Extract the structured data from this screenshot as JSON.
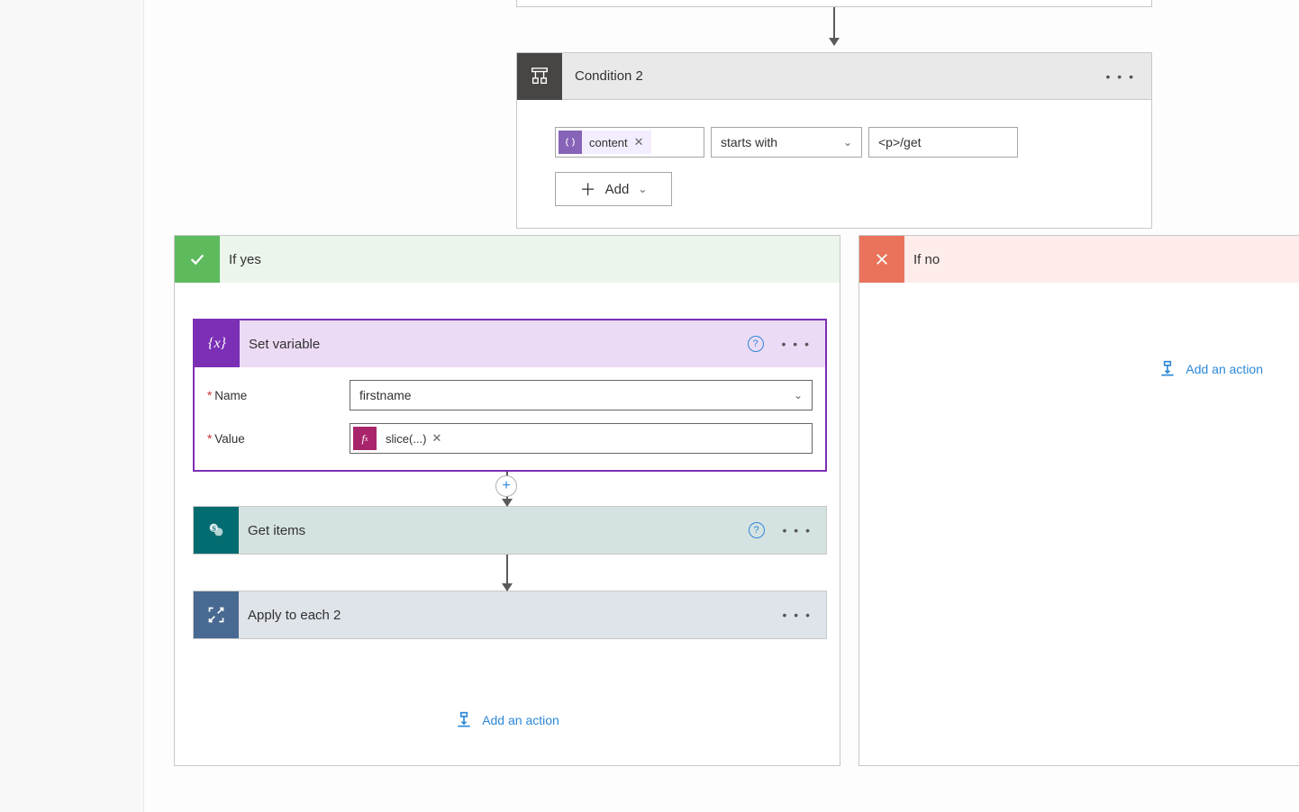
{
  "condition": {
    "title": "Condition 2",
    "token_label": "content",
    "operator": "starts with",
    "value": "<p>/get",
    "add_label": "+ Add"
  },
  "branch_yes": {
    "title": "If yes",
    "set_variable": {
      "title": "Set variable",
      "name_label": "Name",
      "name_value": "firstname",
      "value_label": "Value",
      "fx_label": "slice(...)"
    },
    "get_items": {
      "title": "Get items"
    },
    "apply_each": {
      "title": "Apply to each 2"
    },
    "add_action_label": "Add an action"
  },
  "branch_no": {
    "title": "If no",
    "add_action_label": "Add an action"
  }
}
